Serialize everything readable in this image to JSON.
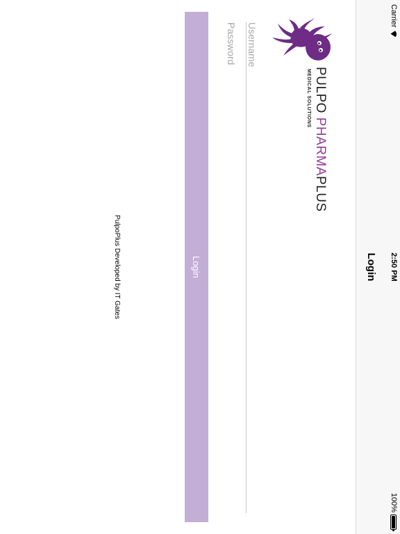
{
  "status_bar": {
    "carrier": "Carrier",
    "time": "2:50 PM",
    "battery": "100%"
  },
  "nav": {
    "title": "Login"
  },
  "logo": {
    "word_part1": "PULPO ",
    "word_part2": "PHARMA",
    "word_part3": "PLUS",
    "tagline": "MEDICAL   SOLUTIONS",
    "colors": {
      "brand_purple": "#6e2c86",
      "accent_purple": "#8e3f96",
      "dark_text": "#231f20"
    }
  },
  "form": {
    "username": {
      "value": "",
      "placeholder": "Username"
    },
    "password": {
      "value": "",
      "placeholder": "Password"
    },
    "login_label": "Login",
    "login_color": "#c3aed6"
  },
  "footer": {
    "text": "PulpoPlus Developed by IT Gates"
  },
  "icons": {
    "wifi": "wifi-icon",
    "battery": "battery-icon",
    "logo": "octopus-logo-icon"
  }
}
